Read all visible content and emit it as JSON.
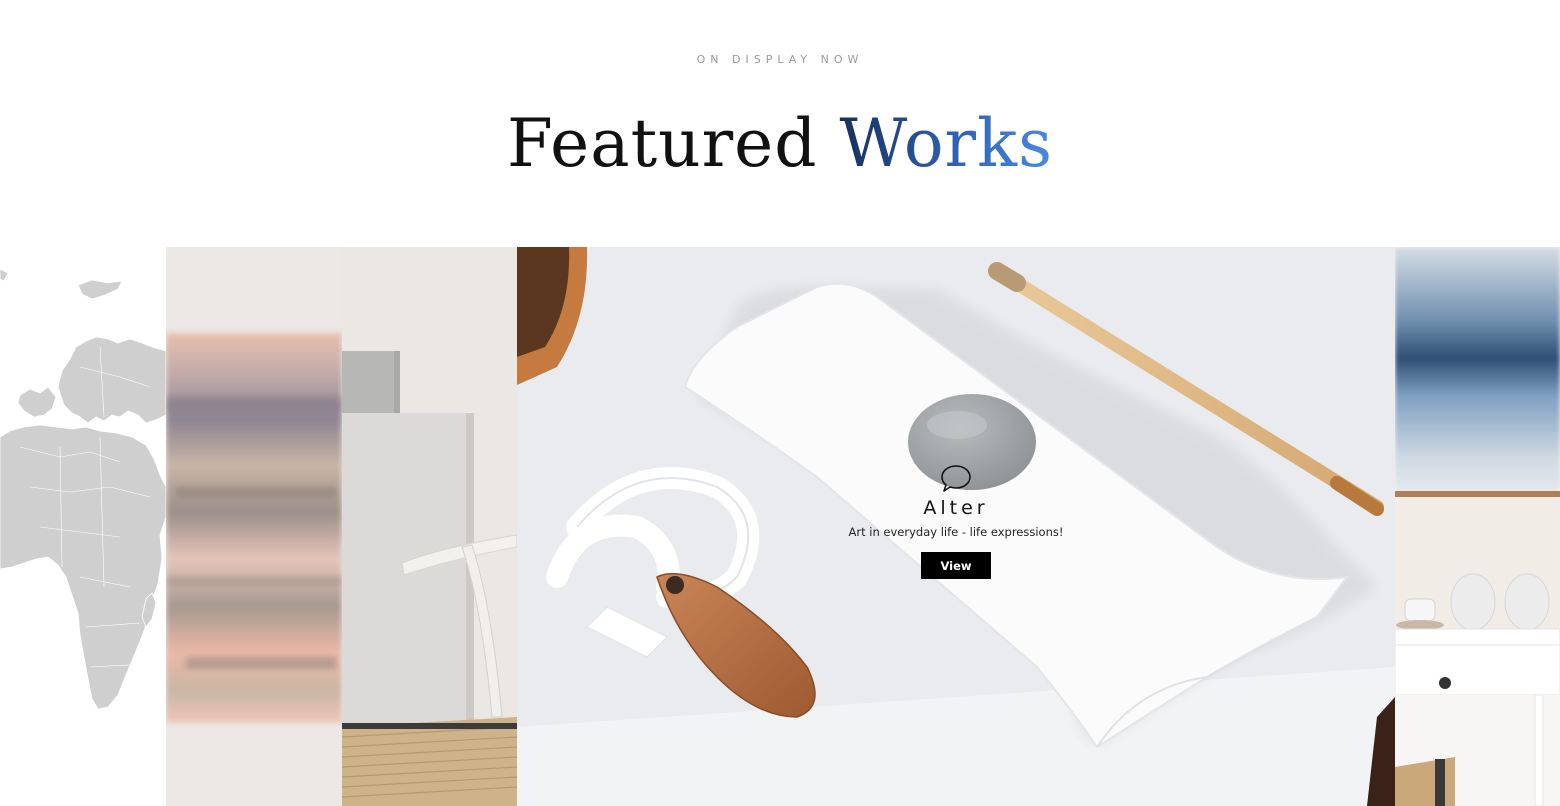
{
  "section": {
    "eyebrow": "ON DISPLAY NOW",
    "title_main": "Featured",
    "title_accent": "Works"
  },
  "featured": {
    "title": "Alter",
    "subtitle": "Art in everyday life - life expressions!",
    "button_label": "View",
    "icon": "speech-bubble-icon"
  },
  "colors": {
    "accent_gradient_start": "#16305a",
    "accent_gradient_end": "#4a8be0",
    "button_bg": "#000000",
    "button_text": "#ffffff",
    "eyebrow": "#9a9a9a"
  }
}
